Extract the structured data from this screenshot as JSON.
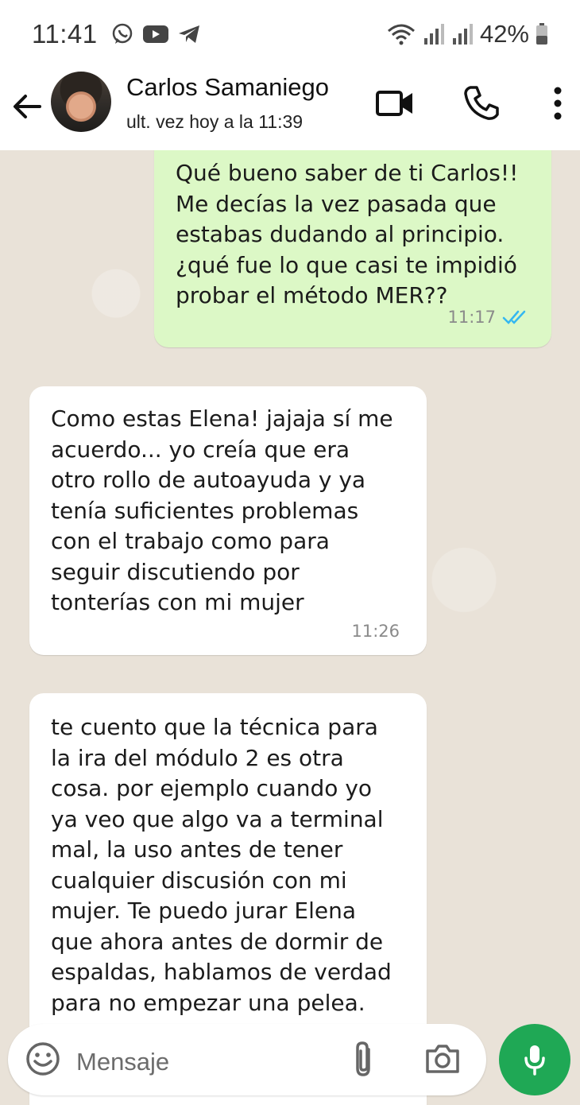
{
  "status_bar": {
    "time": "11:41",
    "battery": "42%"
  },
  "header": {
    "contact_name": "Carlos Samaniego",
    "last_seen": "ult. vez hoy a la 11:39"
  },
  "messages": [
    {
      "direction": "outgoing",
      "text": "Qué bueno saber de ti Carlos!!\nMe decías la vez pasada que\nestabas dudando al principio.\n¿qué fue lo que casi te impidió\nprobar el método MER??",
      "time": "11:17",
      "read": true
    },
    {
      "direction": "incoming",
      "text": "Como estas Elena! jajaja sí me\nacuerdo... yo creía que era\notro rollo de autoayuda y ya\ntenía suficientes problemas\ncon el trabajo como para\nseguir discutiendo por\ntonterías con mi mujer",
      "time": "11:26"
    },
    {
      "direction": "incoming",
      "text": "te cuento que la técnica para\nla ira del módulo 2 es otra\ncosa. por ejemplo cuando yo\nya veo que algo va a terminal\nmal, la uso antes de tener\ncualquier discusión con mi\nmujer. Te puedo jurar Elena\nque ahora antes de dormir de\nespaldas, hablamos de verdad\npara no empezar una pelea."
    }
  ],
  "composer": {
    "placeholder": "Mensaje"
  },
  "colors": {
    "outgoing_bubble": "#dcf8c6",
    "incoming_bubble": "#ffffff",
    "mic_button": "#1fa855",
    "read_ticks": "#34b7f1"
  }
}
